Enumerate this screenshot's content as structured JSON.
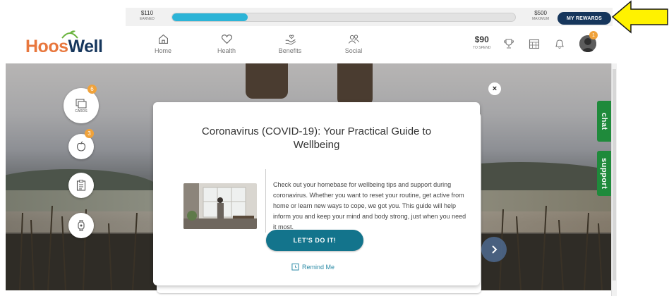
{
  "rewards_bar": {
    "earned_amount": "$110",
    "earned_label": "EARNED",
    "maximum_amount": "$500",
    "maximum_label": "MAXIMUM",
    "progress_fraction": 0.22,
    "button_label": "MY REWARDS"
  },
  "logo": {
    "part1": "Hoos",
    "part2": "Well"
  },
  "nav": {
    "items": [
      {
        "label": "Home",
        "icon": "home-icon"
      },
      {
        "label": "Health",
        "icon": "heart-icon"
      },
      {
        "label": "Benefits",
        "icon": "hand-heart-icon"
      },
      {
        "label": "Social",
        "icon": "people-icon"
      }
    ],
    "spend_amount": "$90",
    "spend_label": "TO SPEND",
    "avatar_badge": "1"
  },
  "side": {
    "cards_badge": "6",
    "cards_label": "CARDS",
    "apple_badge": "3"
  },
  "tabs": {
    "chat": "chat",
    "support": "support"
  },
  "modal": {
    "title": "Coronavirus (COVID-19): Your Practical Guide to Wellbeing",
    "body": "Check out your homebase for wellbeing tips and support during coronavirus. Whether you want to reset your routine, get active from home or learn new ways to cope, we got you. This guide will help inform you and keep your mind and body strong, just when you need it most.",
    "cta_label": "LET'S DO IT!",
    "remind_label": "Remind Me",
    "close_glyph": "×"
  },
  "colors": {
    "brand_navy": "#16365c",
    "brand_orange": "#e8773d",
    "progress": "#2cb4d7",
    "cta": "#13748c",
    "side_tab_green": "#1f8a3b",
    "badge": "#f0a23a"
  }
}
